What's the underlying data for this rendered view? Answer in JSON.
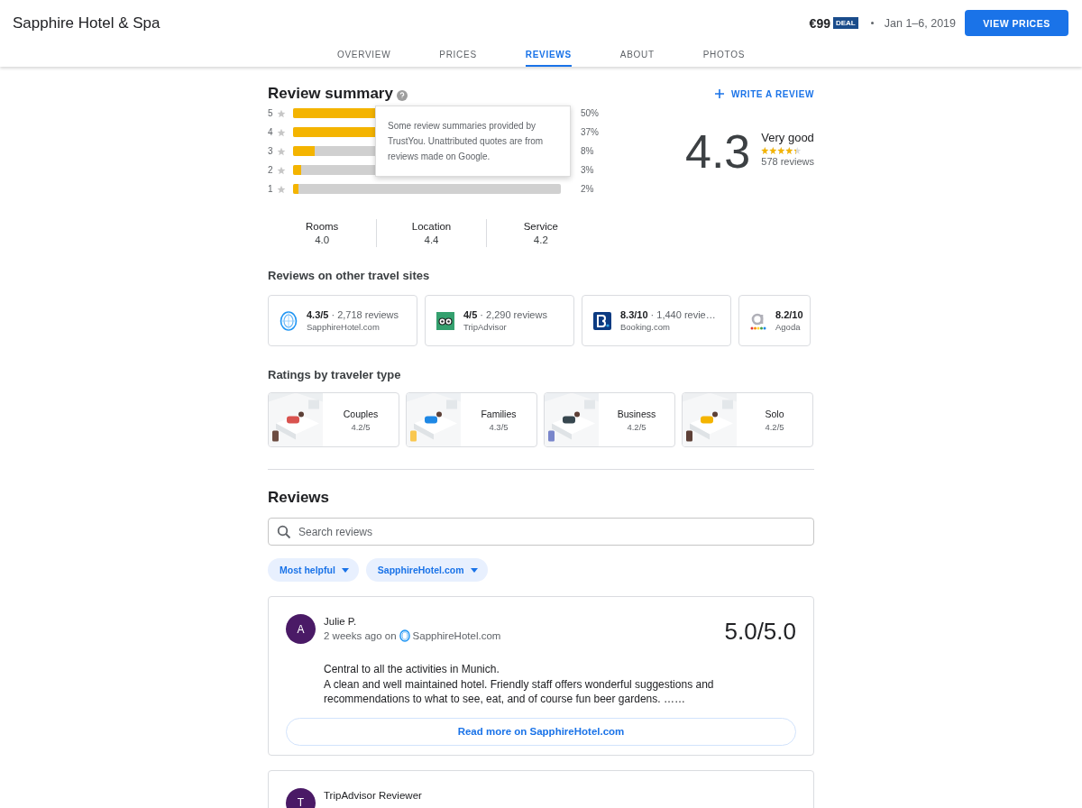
{
  "header": {
    "title": "Sapphire Hotel & Spa",
    "price": "€99",
    "badge": "DEAL",
    "dates": "Jan 1–6, 2019",
    "button": "VIEW PRICES"
  },
  "tabs": [
    {
      "label": "OVERVIEW",
      "selected": false
    },
    {
      "label": "PRICES",
      "selected": false
    },
    {
      "label": "REVIEWS",
      "selected": true
    },
    {
      "label": "ABOUT",
      "selected": false
    },
    {
      "label": "PHOTOS",
      "selected": false
    }
  ],
  "summary": {
    "title": "Review summary",
    "write_button": "WRITE A REVIEW",
    "tooltip": "Some review summaries provided by TrustYou. Unattributed quotes are from reviews made on Google.",
    "distribution": [
      {
        "stars_label": "5",
        "level": 0.5,
        "percent": "50%"
      },
      {
        "stars_label": "4",
        "level": 0.37,
        "percent": "37%"
      },
      {
        "stars_label": "3",
        "level": 0.08,
        "percent": "8%"
      },
      {
        "stars_label": "2",
        "level": 0.03,
        "percent": "3%"
      },
      {
        "stars_label": "1",
        "level": 0.02,
        "percent": "2%"
      }
    ],
    "score": "4.3",
    "verdict": "Very good",
    "stars": 4.3,
    "count": "578 reviews",
    "aspects": [
      {
        "name": "Rooms",
        "value": "4.0"
      },
      {
        "name": "Location",
        "value": "4.4"
      },
      {
        "name": "Service",
        "value": "4.2"
      }
    ]
  },
  "other_sites": {
    "title": "Reviews on other travel sites",
    "sites": [
      {
        "kind": "sapphire",
        "score": "4.3/5",
        "reviews": "· 2,718 reviews",
        "name": "SapphireHotel.com"
      },
      {
        "kind": "tripadvisor",
        "score": "4/5",
        "reviews": "· 2,290 reviews",
        "name": "TripAdvisor"
      },
      {
        "kind": "booking",
        "score": "8.3/10",
        "reviews": "· 1,440 revie…",
        "name": "Booking.com"
      },
      {
        "kind": "agoda",
        "score": "8.2/10",
        "name": "Agoda"
      }
    ]
  },
  "traveler_types": {
    "title": "Ratings by traveler type",
    "types": [
      {
        "name": "Couples",
        "rating": "4.2/5",
        "kind": "picture"
      },
      {
        "name": "Families",
        "rating": "4.3/5",
        "kind": "picture"
      },
      {
        "name": "Business",
        "rating": "4.2/5",
        "kind": "picture"
      },
      {
        "name": "Solo",
        "rating": "4.2/5",
        "kind": "picture"
      }
    ]
  },
  "reviews": {
    "title": "Reviews",
    "search_placeholder": "Search reviews",
    "filters": [
      "Most helpful",
      "SapphireHotel.com"
    ],
    "items": [
      {
        "initial": "A",
        "author": "Julie P.",
        "when": "2 weeks ago on",
        "source": {
          "kind": "sapphire",
          "name": "SapphireHotel.com"
        },
        "score": "5.0/5.0",
        "text": [
          "Central to all the activities in Munich.",
          "A clean and well maintained hotel. Friendly staff offers wonderful suggestions and recommendations to what to see, eat, and of course fun beer gardens. ……"
        ],
        "read_more": "Read more on SapphireHotel.com"
      },
      {
        "initial": "T",
        "author": "TripAdvisor Reviewer"
      }
    ]
  }
}
